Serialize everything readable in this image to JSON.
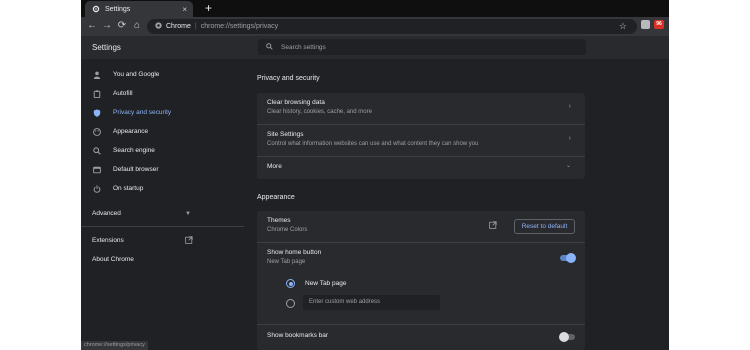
{
  "tab": {
    "title": "Settings",
    "close": "×"
  },
  "toolbar": {
    "back": "←",
    "forward": "→",
    "reload": "⟳",
    "home": "⌂",
    "site_name": "Chrome",
    "separator": "|",
    "url": "chrome://settings/privacy",
    "star": "☆",
    "profile_badge": "96"
  },
  "header": {
    "title": "Settings",
    "search_placeholder": "Search settings"
  },
  "sidebar": {
    "items": [
      {
        "label": "You and Google",
        "icon": "person-icon"
      },
      {
        "label": "Autofill",
        "icon": "clipboard-icon"
      },
      {
        "label": "Privacy and security",
        "icon": "shield-icon"
      },
      {
        "label": "Appearance",
        "icon": "palette-icon"
      },
      {
        "label": "Search engine",
        "icon": "search-icon"
      },
      {
        "label": "Default browser",
        "icon": "browser-icon"
      },
      {
        "label": "On startup",
        "icon": "power-icon"
      }
    ],
    "advanced": "Advanced",
    "extensions": "Extensions",
    "about": "About Chrome"
  },
  "privacy": {
    "title": "Privacy and security",
    "clear_title": "Clear browsing data",
    "clear_sub": "Clear history, cookies, cache, and more",
    "site_title": "Site Settings",
    "site_sub": "Control what information websites can use and what content they can show you",
    "more": "More"
  },
  "appearance": {
    "title": "Appearance",
    "themes_title": "Themes",
    "themes_sub": "Chrome Colors",
    "reset": "Reset to default",
    "home_title": "Show home button",
    "home_sub": "New Tab page",
    "home_enabled": true,
    "radio_newtab": "New Tab page",
    "radio_custom_placeholder": "Enter custom web address",
    "bookmarks_title": "Show bookmarks bar",
    "bookmarks_enabled": false
  },
  "status": {
    "url": "chrome://settings/privacy"
  },
  "colors": {
    "accent": "#8ab4f8",
    "background": "#202124",
    "card": "#292a2d"
  }
}
